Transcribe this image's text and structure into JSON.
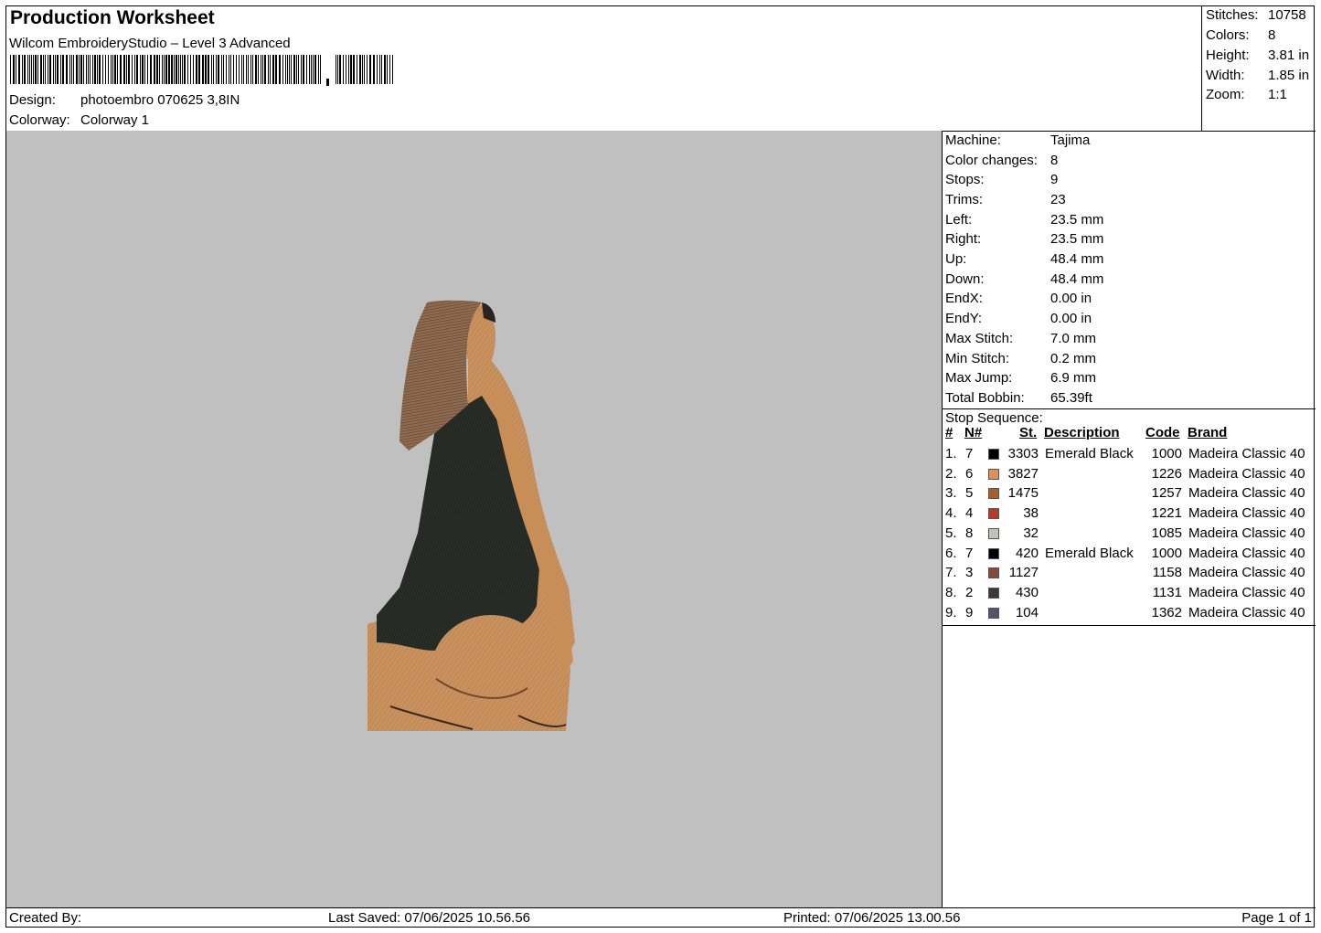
{
  "header": {
    "title": "Production Worksheet",
    "software": "Wilcom EmbroideryStudio – Level 3 Advanced",
    "design_label": "Design:",
    "design_value": "photoembro 070625 3,8IN",
    "colorway_label": "Colorway:",
    "colorway_value": "Colorway 1"
  },
  "stats": [
    {
      "label": "Stitches:",
      "value": "10758"
    },
    {
      "label": "Colors:",
      "value": "8"
    },
    {
      "label": "Height:",
      "value": "3.81 in"
    },
    {
      "label": "Width:",
      "value": "1.85 in"
    },
    {
      "label": "Zoom:",
      "value": "1:1"
    }
  ],
  "machine_info": [
    {
      "label": "Machine:",
      "value": "Tajima"
    },
    {
      "label": "Color changes:",
      "value": "8"
    },
    {
      "label": "Stops:",
      "value": "9"
    },
    {
      "label": "Trims:",
      "value": "23"
    },
    {
      "label": "Left:",
      "value": "23.5 mm"
    },
    {
      "label": "Right:",
      "value": "23.5 mm"
    },
    {
      "label": "Up:",
      "value": "48.4 mm"
    },
    {
      "label": "Down:",
      "value": "48.4 mm"
    },
    {
      "label": "EndX:",
      "value": "0.00 in"
    },
    {
      "label": "EndY:",
      "value": "0.00 in"
    },
    {
      "label": "Max Stitch:",
      "value": "7.0 mm"
    },
    {
      "label": "Min Stitch:",
      "value": "0.2 mm"
    },
    {
      "label": "Max Jump:",
      "value": "6.9 mm"
    },
    {
      "label": "Total Bobbin:",
      "value": "65.39ft"
    }
  ],
  "stop_sequence": {
    "title": "Stop Sequence:",
    "columns": [
      "#",
      "N#",
      "St.",
      "Description",
      "Code",
      "Brand"
    ],
    "rows": [
      {
        "idx": "1.",
        "n": "7",
        "color": "#000000",
        "st": "3303",
        "desc": "Emerald Black",
        "code": "1000",
        "brand": "Madeira Classic 40"
      },
      {
        "idx": "2.",
        "n": "6",
        "color": "#d9925a",
        "st": "3827",
        "desc": "",
        "code": "1226",
        "brand": "Madeira Classic 40"
      },
      {
        "idx": "3.",
        "n": "5",
        "color": "#a5602e",
        "st": "1475",
        "desc": "",
        "code": "1257",
        "brand": "Madeira Classic 40"
      },
      {
        "idx": "4.",
        "n": "4",
        "color": "#b63b2c",
        "st": "38",
        "desc": "",
        "code": "1221",
        "brand": "Madeira Classic 40"
      },
      {
        "idx": "5.",
        "n": "8",
        "color": "#c2c0b8",
        "st": "32",
        "desc": "",
        "code": "1085",
        "brand": "Madeira Classic 40"
      },
      {
        "idx": "6.",
        "n": "7",
        "color": "#000000",
        "st": "420",
        "desc": "Emerald Black",
        "code": "1000",
        "brand": "Madeira Classic 40"
      },
      {
        "idx": "7.",
        "n": "3",
        "color": "#8a4a3a",
        "st": "1127",
        "desc": "",
        "code": "1158",
        "brand": "Madeira Classic 40"
      },
      {
        "idx": "8.",
        "n": "2",
        "color": "#3e3834",
        "st": "430",
        "desc": "",
        "code": "1131",
        "brand": "Madeira Classic 40"
      },
      {
        "idx": "9.",
        "n": "9",
        "color": "#55526a",
        "st": "104",
        "desc": "",
        "code": "1362",
        "brand": "Madeira Classic 40"
      }
    ]
  },
  "footer": {
    "created_by": "Created By:",
    "last_saved": "Last Saved: 07/06/2025 10.56.56",
    "printed": "Printed: 07/06/2025 13.00.56",
    "page": "Page 1 of 1"
  },
  "colors": {
    "canvas_bg": "#c0c0c0",
    "skin": "#c8915e",
    "hair": "#8e6a4f",
    "garment": "#1f241e"
  }
}
